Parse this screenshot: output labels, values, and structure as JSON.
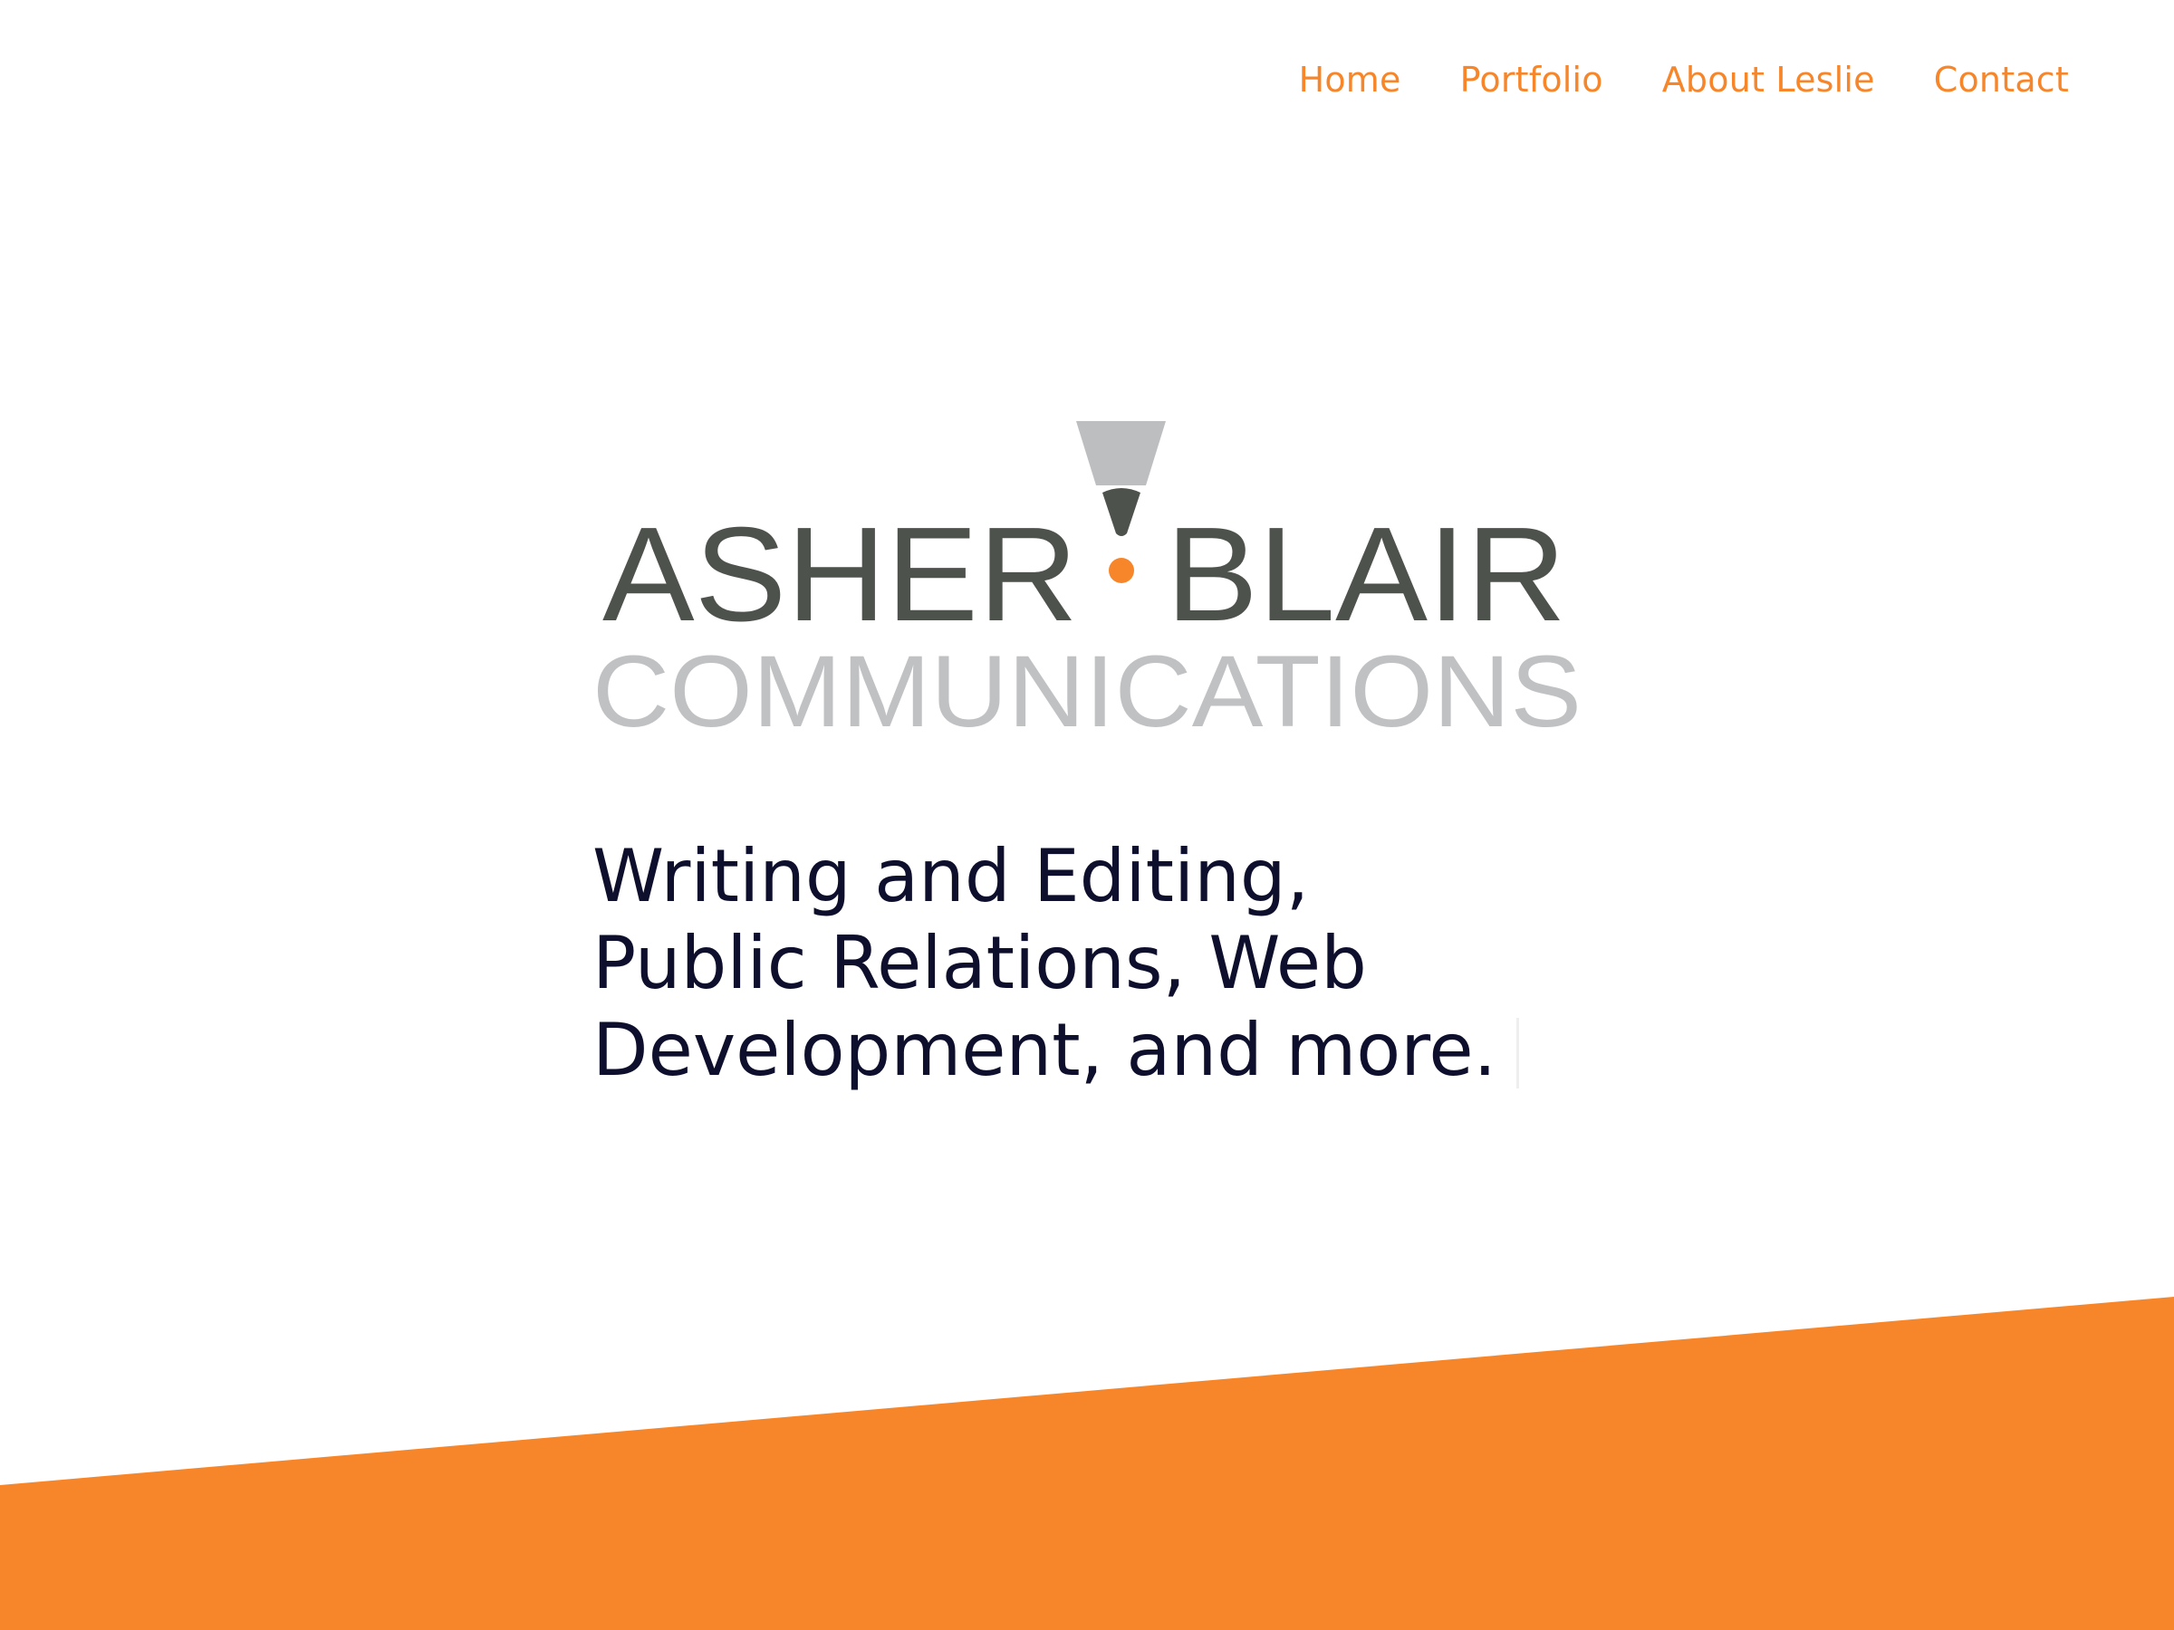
{
  "nav": {
    "items": [
      {
        "label": "Home"
      },
      {
        "label": "Portfolio"
      },
      {
        "label": "About Leslie"
      },
      {
        "label": "Contact"
      }
    ]
  },
  "logo": {
    "word_left": "ASHER",
    "word_right": "BLAIR",
    "subtitle": "COMMUNICATIONS",
    "colors": {
      "wordmark": "#4e524c",
      "subtitle": "#c0c1c3",
      "nib": "#bdbec0",
      "accent": "#f7862a"
    }
  },
  "hero": {
    "tagline_lines": [
      "Writing and Editing,",
      "Public Relations, Web",
      "Development, and more."
    ]
  },
  "theme": {
    "accent": "#f7862a",
    "text_dark": "#0e0f2c",
    "background": "#ffffff"
  }
}
